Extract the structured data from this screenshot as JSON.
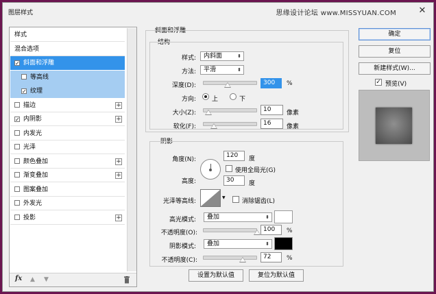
{
  "window": {
    "title": "图层样式",
    "watermark": "思缘设计论坛 www.MISSYUAN.COM",
    "close_icon": "close-icon"
  },
  "left_panel": {
    "items": [
      {
        "label": "样式",
        "checkbox": false,
        "checked": false,
        "plus": false,
        "state": "normal",
        "indent": false
      },
      {
        "label": "混合选项",
        "checkbox": false,
        "checked": false,
        "plus": false,
        "state": "normal",
        "indent": false
      },
      {
        "label": "斜面和浮雕",
        "checkbox": true,
        "checked": true,
        "plus": false,
        "state": "selected",
        "indent": false
      },
      {
        "label": "等高线",
        "checkbox": true,
        "checked": false,
        "plus": false,
        "state": "sub",
        "indent": true
      },
      {
        "label": "纹理",
        "checkbox": true,
        "checked": true,
        "plus": false,
        "state": "sub",
        "indent": true
      },
      {
        "label": "描边",
        "checkbox": true,
        "checked": false,
        "plus": true,
        "state": "normal",
        "indent": false
      },
      {
        "label": "内阴影",
        "checkbox": true,
        "checked": true,
        "plus": true,
        "state": "normal",
        "indent": false
      },
      {
        "label": "内发光",
        "checkbox": true,
        "checked": false,
        "plus": false,
        "state": "normal",
        "indent": false
      },
      {
        "label": "光泽",
        "checkbox": true,
        "checked": false,
        "plus": false,
        "state": "normal",
        "indent": false
      },
      {
        "label": "颜色叠加",
        "checkbox": true,
        "checked": false,
        "plus": true,
        "state": "normal",
        "indent": false
      },
      {
        "label": "渐变叠加",
        "checkbox": true,
        "checked": false,
        "plus": true,
        "state": "normal",
        "indent": false
      },
      {
        "label": "图案叠加",
        "checkbox": true,
        "checked": false,
        "plus": false,
        "state": "normal",
        "indent": false
      },
      {
        "label": "外发光",
        "checkbox": true,
        "checked": false,
        "plus": false,
        "state": "normal",
        "indent": false
      },
      {
        "label": "投影",
        "checkbox": true,
        "checked": false,
        "plus": true,
        "state": "normal",
        "indent": false
      }
    ],
    "footer": {
      "fx_label": "fx",
      "up_icon": "arrow-up-icon",
      "down_icon": "arrow-down-icon",
      "trash_icon": "trash-icon"
    }
  },
  "bevel": {
    "section_title": "斜面和浮雕",
    "structure_title": "结构",
    "style_label": "样式:",
    "style_value": "内斜面",
    "technique_label": "方法:",
    "technique_value": "平滑",
    "depth_label": "深度(D):",
    "depth_value": "300",
    "depth_unit": "%",
    "direction_label": "方向:",
    "dir_up": "上",
    "dir_down": "下",
    "direction_selected": "上",
    "size_label": "大小(Z):",
    "size_value": "10",
    "size_unit": "像素",
    "soften_label": "软化(F):",
    "soften_value": "16",
    "soften_unit": "像素"
  },
  "shading": {
    "title": "阴影",
    "angle_label": "角度(N):",
    "angle_value": "120",
    "angle_unit": "度",
    "global_light_label": "使用全局光(G)",
    "global_light_checked": false,
    "altitude_label": "高度:",
    "altitude_value": "30",
    "altitude_unit": "度",
    "gloss_contour_label": "光泽等高线:",
    "antialias_label": "消除锯齿(L)",
    "antialias_checked": false,
    "highlight_mode_label": "高光模式:",
    "highlight_mode_value": "叠加",
    "highlight_color": "#ffffff",
    "highlight_opacity_label": "不透明度(O):",
    "highlight_opacity_value": "100",
    "highlight_opacity_unit": "%",
    "shadow_mode_label": "阴影模式:",
    "shadow_mode_value": "叠加",
    "shadow_color": "#000000",
    "shadow_opacity_label": "不透明度(C):",
    "shadow_opacity_value": "72",
    "shadow_opacity_unit": "%"
  },
  "bottom_buttons": {
    "make_default": "设置为默认值",
    "reset_default": "复位为默认值"
  },
  "right": {
    "ok": "确定",
    "reset": "复位",
    "new_style": "新建样式(W)...",
    "preview_label": "预览(V)",
    "preview_checked": true
  },
  "colors": {
    "selected": "#3393ea",
    "sub_selected": "#a5cdf2"
  }
}
